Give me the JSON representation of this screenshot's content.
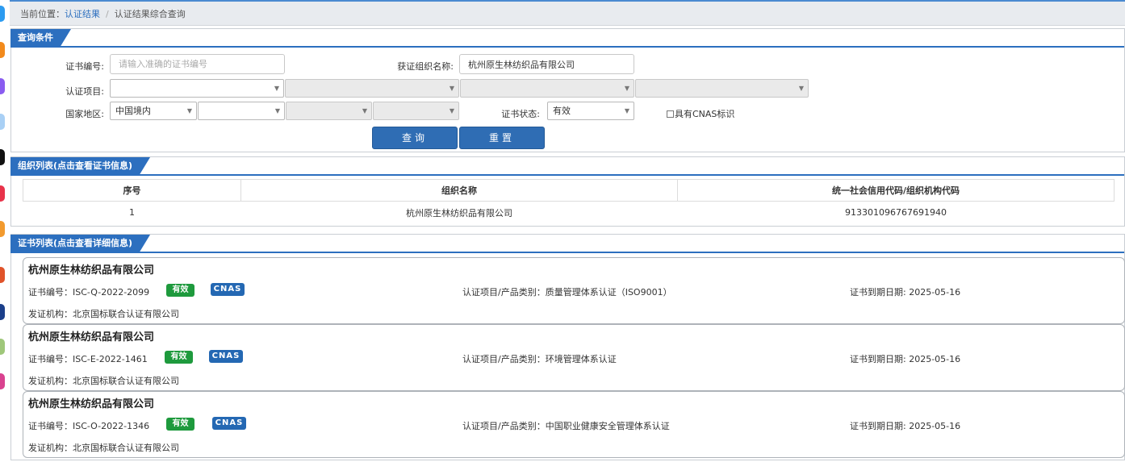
{
  "breadcrumb": {
    "prefix": "当前位置：",
    "link": "认证结果",
    "sep": "/",
    "current": "认证结果综合查询"
  },
  "query": {
    "header": "查询条件",
    "cert_no_label": "证书编号:",
    "cert_no_placeholder": "请输入准确的证书编号",
    "org_name_label": "获证组织名称:",
    "org_name_value": "杭州原生林纺织品有限公司",
    "project_label": "认证项目:",
    "region_label": "国家地区:",
    "region_value": "中国境内",
    "status_label": "证书状态:",
    "status_value": "有效",
    "cnas_label": "具有CNAS标识",
    "search_btn": "查询",
    "reset_btn": "重置"
  },
  "org_list": {
    "header": "组织列表(点击查看证书信息)",
    "columns": [
      "序号",
      "组织名称",
      "统一社会信用代码/组织机构代码"
    ],
    "rows": [
      [
        "1",
        "杭州原生林纺织品有限公司",
        "913301096767691940"
      ]
    ]
  },
  "cert_list": {
    "header": "证书列表(点击查看详细信息)",
    "cards": [
      {
        "company": "杭州原生林纺织品有限公司",
        "cert_no": "证书编号：ISC-Q-2022-2099",
        "status": "有效",
        "cnas": "CNAS",
        "project": "认证项目/产品类别：质量管理体系认证（ISO9001）",
        "expiry": "证书到期日期: 2025-05-16",
        "issuer": "发证机构：北京国标联合认证有限公司"
      },
      {
        "company": "杭州原生林纺织品有限公司",
        "cert_no": "证书编号：ISC-E-2022-1461",
        "status": "有效",
        "cnas": "CNAS",
        "project": "认证项目/产品类别：环境管理体系认证",
        "expiry": "证书到期日期: 2025-05-16",
        "issuer": "发证机构：北京国标联合认证有限公司"
      },
      {
        "company": "杭州原生林纺织品有限公司",
        "cert_no": "证书编号：ISC-O-2022-1346",
        "status": "有效",
        "cnas": "CNAS",
        "project": "认证项目/产品类别：中国职业健康安全管理体系认证",
        "expiry": "证书到期日期: 2025-05-16",
        "issuer": "发证机构：北京国标联合认证有限公司"
      }
    ]
  },
  "colors": {
    "accent": "#2c6fbf",
    "button": "#2f6db4",
    "valid_badge": "#1e9a3d",
    "cnas_badge": "#2468b3"
  }
}
